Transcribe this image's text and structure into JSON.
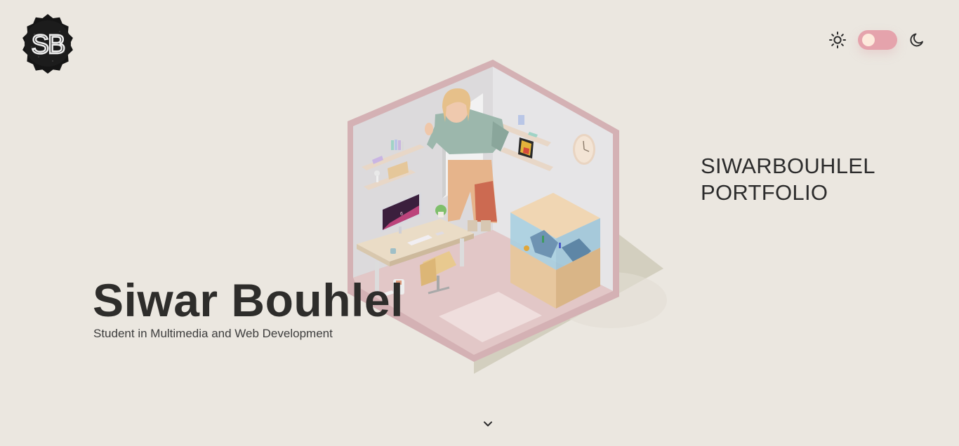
{
  "logo": {
    "text": "SB"
  },
  "theme_toggle": {
    "left_icon": "sun-icon",
    "right_icon": "moon-icon",
    "state": "light",
    "track_color": "#e5a3ac",
    "knob_color": "#fdeadc"
  },
  "hero": {
    "name": "Siwar Bouhlel",
    "subtitle": "Student in Multimedia and Web Development"
  },
  "side_title": {
    "line1": "SIWARBOUHLEL",
    "line2": "PORTFOLIO"
  },
  "room_illustration": {
    "screen_text": "6"
  },
  "scroll": {
    "icon": "chevron-down-icon"
  },
  "colors": {
    "background": "#ebe7e0",
    "text": "#2e2d2b",
    "accent": "#e5a3ac"
  }
}
